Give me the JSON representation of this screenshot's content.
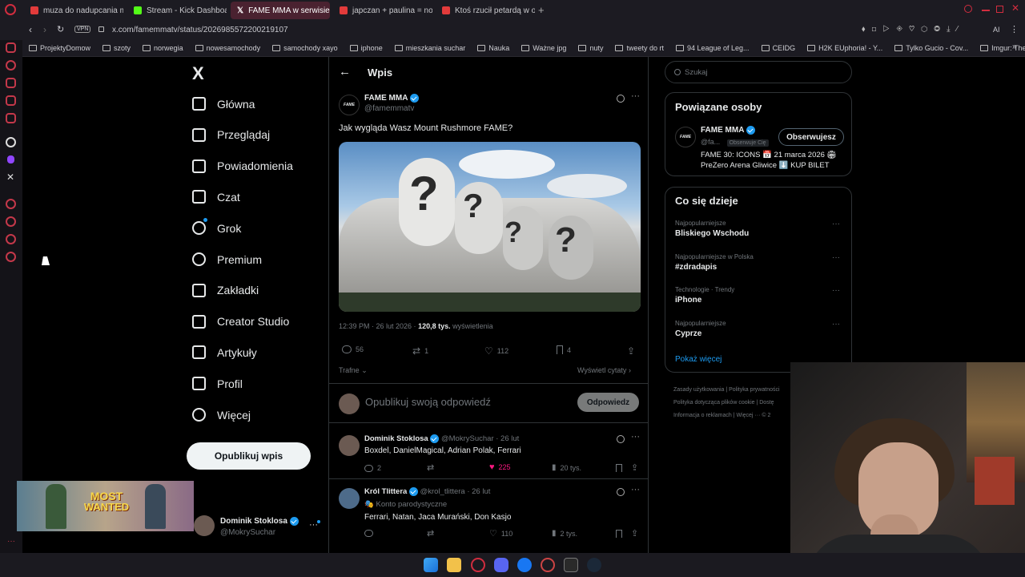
{
  "browser": {
    "tabs": [
      {
        "label": "muza do nadupcania m",
        "color": "#e23b3b"
      },
      {
        "label": "Stream - Kick Dashboard",
        "color": "#53fc18"
      },
      {
        "label": "FAME MMA w serwisie X:",
        "color": "#ffffff",
        "active": true
      },
      {
        "label": "japczan + paulina = norma",
        "color": "#e23b3b"
      },
      {
        "label": "Ktoś rzucił petardą w okno",
        "color": "#e23b3b"
      }
    ],
    "url": "x.com/famemmatv/status/2026985572200219107",
    "vpn": "VPN",
    "ai_label": "AI",
    "bookmarks": [
      "ProjektyDomow",
      "szoty",
      "norwegia",
      "nowesamochody",
      "samochody xayo",
      "iphone",
      "mieszkania suchar",
      "Nauka",
      "Ważne jpg",
      "nuty",
      "tweety do rt",
      "94 League of Leg...",
      "CEIDG",
      "H2K EUphoria! - Y...",
      "Tylko Gucio - Cov...",
      "Imgur: The most a..."
    ]
  },
  "nav": {
    "logo": "X",
    "items": [
      "Główna",
      "Przeglądaj",
      "Powiadomienia",
      "Czat",
      "Grok",
      "Premium",
      "Zakładki",
      "Creator Studio",
      "Artykuły",
      "Profil",
      "Więcej"
    ],
    "post_button": "Opublikuj wpis",
    "account_name": "Dominik Stoklosa",
    "account_handle": "@MokrySuchar"
  },
  "overlay": {
    "game_line1": "MOST",
    "game_line2": "WANTED"
  },
  "post": {
    "header": "Wpis",
    "author": "FAME MMA",
    "handle": "@famemmatv",
    "avatar_text": "FAME",
    "text": "Jak wygląda Wasz Mount Rushmore FAME?",
    "time": "12:39 PM · 26 lut 2026 ·",
    "views_value": "120,8 tys.",
    "views_label": "wyświetlenia",
    "replies": "56",
    "reposts": "1",
    "likes": "112",
    "bookmarks": "4",
    "sort": "Trafne",
    "quotes": "Wyświetl cytaty",
    "reply_placeholder": "Opublikuj swoją odpowiedź",
    "reply_button": "Odpowiedz"
  },
  "replies": [
    {
      "name": "Dominik Stoklosa",
      "handle": "@MokrySuchar · 26 lut",
      "text": "Boxdel, DanielMagical, Adrian Polak, Ferrari",
      "replies": "2",
      "reposts": "",
      "likes": "225",
      "views": "20 tys.",
      "badge": ""
    },
    {
      "name": "Król Tlittera",
      "handle": "@krol_tlittera · 26 lut",
      "text": "Ferrari, Natan, Jaca Murański, Don Kasjo",
      "replies": "",
      "reposts": "",
      "likes": "110",
      "views": "2 tys.",
      "badge": "Konto parodystyczne"
    }
  ],
  "sidebar": {
    "search_placeholder": "Szukaj",
    "related_title": "Powiązane osoby",
    "person_name": "FAME MMA",
    "person_handle": "@fa...",
    "follows_you": "Obserwuje Cię",
    "follow_button": "Obserwujesz",
    "bio_line1": "FAME 30: ICONS 📅 21 marca 2026 🏟",
    "bio_line2": "PreZero Arena Gliwice ⬇️ KUP BILET",
    "trends_title": "Co się dzieje",
    "trends": [
      {
        "category": "Najpopularniejsze",
        "name": "Bliskiego Wschodu"
      },
      {
        "category": "Najpopularniejsze w Polska",
        "name": "#zdradapis"
      },
      {
        "category": "Technologie · Trendy",
        "name": "iPhone"
      },
      {
        "category": "Najpopularniejsze",
        "name": "Cyprze"
      }
    ],
    "show_more": "Pokaż więcej",
    "footer_line1": "Zasady użytkowania  |  Polityka prywatności",
    "footer_line2": "Polityka dotycząca plików cookie  |  Dostę",
    "footer_line3": "Informacja o reklamach  |  Więcej ···  © 2"
  },
  "colors": {
    "accent": "#1d9bf0",
    "like": "#f91880",
    "opera": "#c4384a"
  }
}
